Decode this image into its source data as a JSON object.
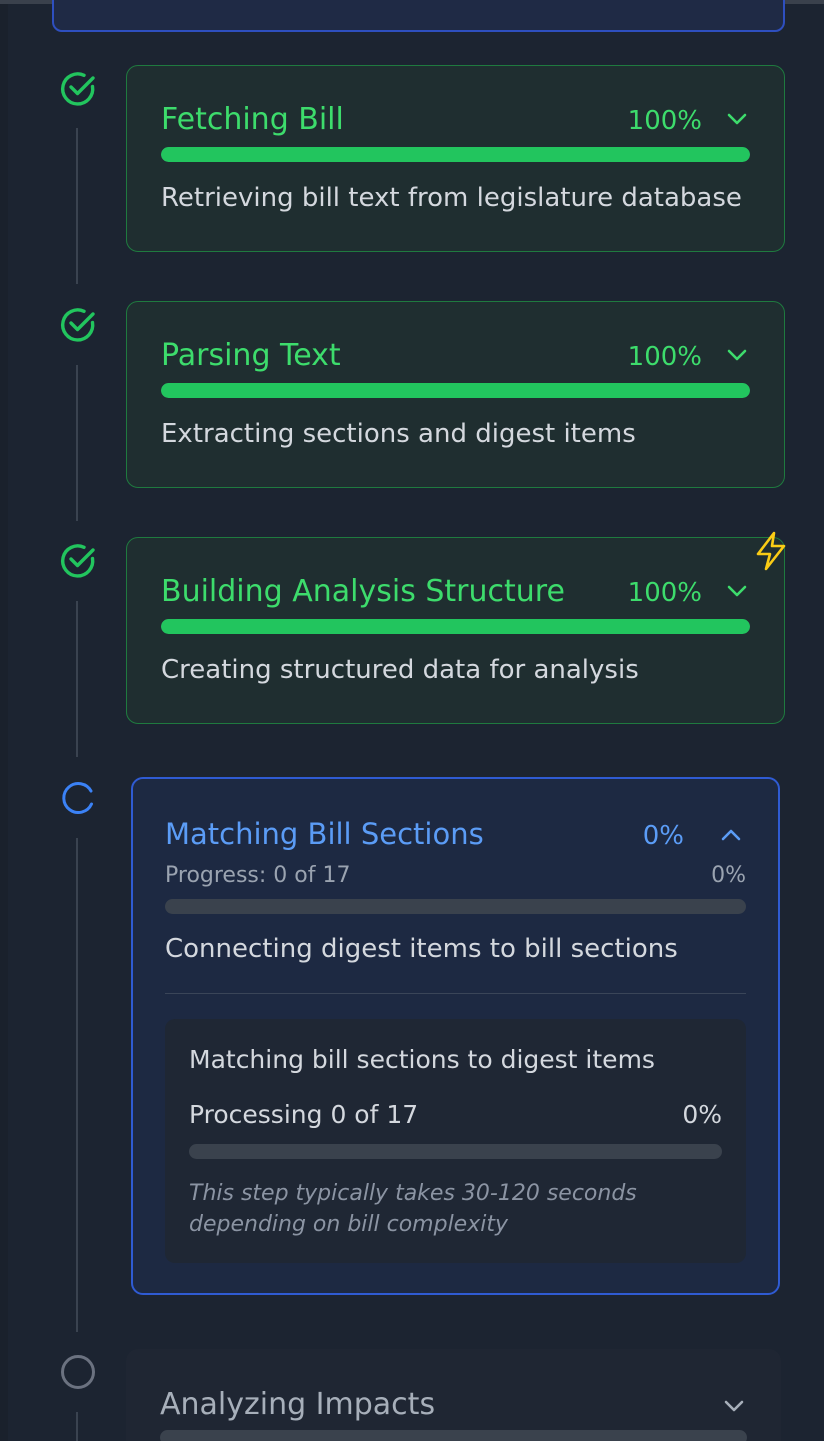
{
  "steps": [
    {
      "title": "Fetching Bill",
      "percent": "100%",
      "progress": 1.0,
      "description": "Retrieving bill text from legislature database",
      "status": "complete",
      "icon": "check-circle-icon"
    },
    {
      "title": "Parsing Text",
      "percent": "100%",
      "progress": 1.0,
      "description": "Extracting sections and digest items",
      "status": "complete",
      "icon": "check-circle-icon"
    },
    {
      "title": "Building Analysis Structure",
      "percent": "100%",
      "progress": 1.0,
      "description": "Creating structured data for analysis",
      "status": "complete",
      "icon": "check-circle-icon",
      "badge_icon": "lightning-bolt-icon"
    }
  ],
  "active_step": {
    "title": "Matching Bill Sections",
    "percent": "0%",
    "progress_label": "Progress: 0 of 17",
    "progress_percent": "0%",
    "progress": 0,
    "description": "Connecting digest items to bill sections",
    "status": "in-progress",
    "icon": "spinner-icon",
    "detail": {
      "title": "Matching bill sections to digest items",
      "processing_label": "Processing 0 of 17",
      "processing_percent": "0%",
      "progress": 0,
      "note": "This step typically takes 30-120 seconds depending on bill complexity"
    }
  },
  "pending_step": {
    "title": "Analyzing Impacts",
    "status": "pending",
    "icon": "empty-circle-icon"
  },
  "colors": {
    "background": "#1c2431",
    "complete": "#22c55e",
    "active": "#3b82f6",
    "pending": "#6b7280",
    "bolt": "#facc15"
  }
}
